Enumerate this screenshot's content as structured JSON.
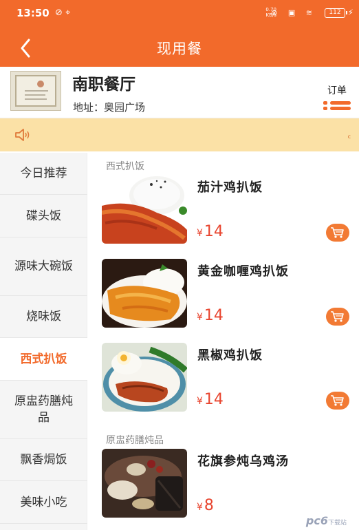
{
  "status_bar": {
    "time": "13:50",
    "left_icons": "⊘ ⌖",
    "network_speed": "0.70\nKB/s",
    "right_icons": "⊗ ▣ ≋",
    "battery": "112"
  },
  "header": {
    "title": "现用餐"
  },
  "restaurant": {
    "name": "南职餐厅",
    "address": "地址：奥园广场",
    "order_label": "订单"
  },
  "notice": {
    "text": "c"
  },
  "categories": [
    {
      "label": "今日推荐"
    },
    {
      "label": "碟头饭"
    },
    {
      "label": "源味大碗饭"
    },
    {
      "label": "烧味饭"
    },
    {
      "label": "西式扒饭",
      "active": true
    },
    {
      "label": "原盅药膳炖品"
    },
    {
      "label": "飘香焗饭"
    },
    {
      "label": "美味小吃"
    }
  ],
  "sections": [
    {
      "title": "西式扒饭",
      "items": [
        {
          "name": "茄汁鸡扒饭",
          "currency": "¥",
          "price": "14"
        },
        {
          "name": "黄金咖喱鸡扒饭",
          "currency": "¥",
          "price": "14"
        },
        {
          "name": "黑椒鸡扒饭",
          "currency": "¥",
          "price": "14"
        }
      ]
    },
    {
      "title": "原盅药膳炖品",
      "items": [
        {
          "name": "花旗参炖乌鸡汤",
          "currency": "¥",
          "price": "8"
        }
      ]
    }
  ],
  "watermark": {
    "text": "pc6",
    "sub": "下载站"
  },
  "colors": {
    "accent": "#f26a2b",
    "price": "#e8452f",
    "notice_bg": "#fbe1a6"
  }
}
